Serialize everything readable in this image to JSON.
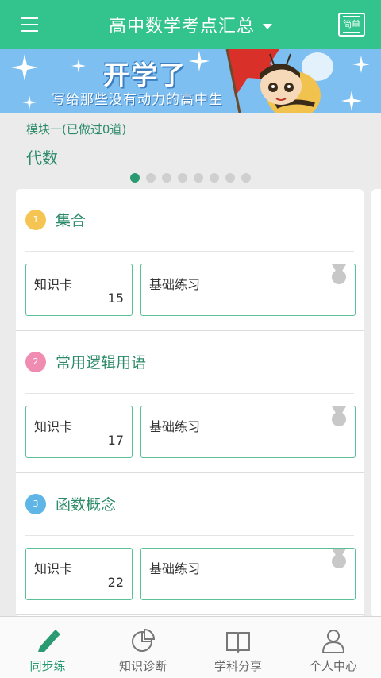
{
  "header": {
    "title": "高中数学考点汇总",
    "mode_button_label": "简单"
  },
  "banner": {
    "title": "开学了",
    "subtitle": "写给那些没有动力的高中生"
  },
  "module": {
    "meta": "模块一(已做过0道)",
    "name": "代数"
  },
  "pager": {
    "total": 8,
    "active_index": 0
  },
  "sections": [
    {
      "number": "1",
      "title": "集合",
      "badge_color": "#f5c453",
      "knowledge_label": "知识卡",
      "knowledge_count": "15",
      "practice_label": "基础练习"
    },
    {
      "number": "2",
      "title": "常用逻辑用语",
      "badge_color": "#f08cb1",
      "knowledge_label": "知识卡",
      "knowledge_count": "17",
      "practice_label": "基础练习"
    },
    {
      "number": "3",
      "title": "函数概念",
      "badge_color": "#5fb6e6",
      "knowledge_label": "知识卡",
      "knowledge_count": "22",
      "practice_label": "基础练习"
    }
  ],
  "bottom_nav": [
    {
      "label": "同步练",
      "icon": "pencil-icon",
      "active": true
    },
    {
      "label": "知识诊断",
      "icon": "pie-chart-icon",
      "active": false
    },
    {
      "label": "学科分享",
      "icon": "book-icon",
      "active": false
    },
    {
      "label": "个人中心",
      "icon": "person-icon",
      "active": false
    }
  ],
  "colors": {
    "brand_green": "#33c48e",
    "accent_green": "#2a9a72",
    "banner_blue": "#7cbff0"
  }
}
